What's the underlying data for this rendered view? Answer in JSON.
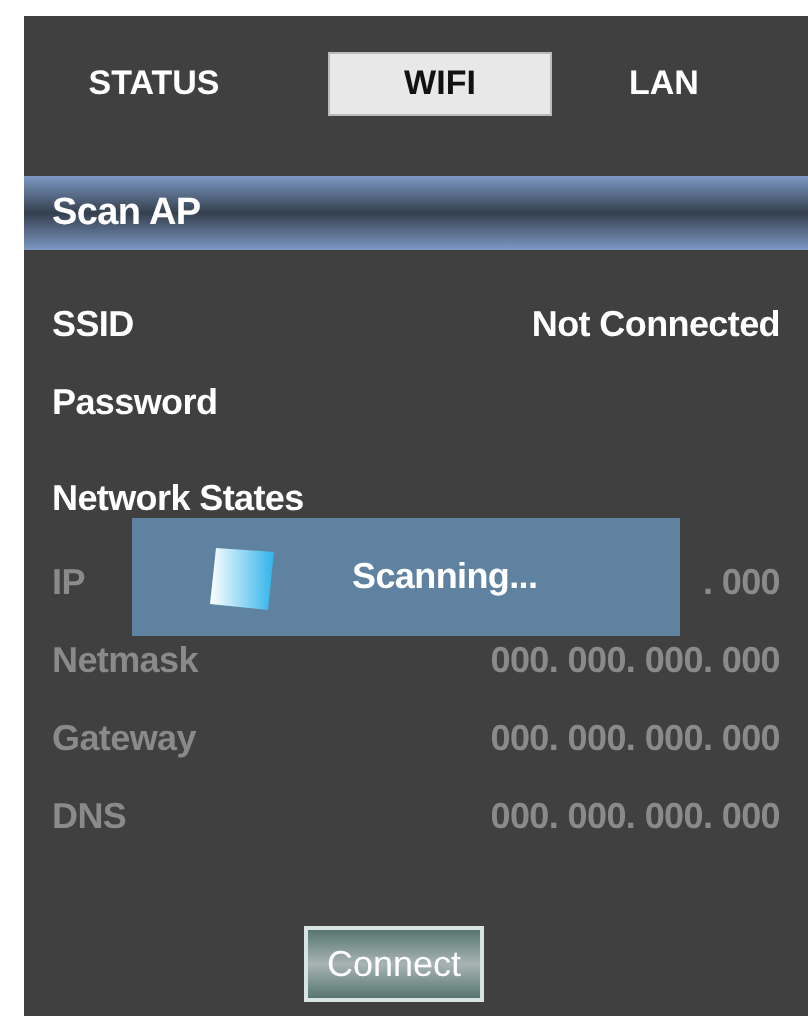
{
  "tabs": [
    {
      "label": "STATUS",
      "selected": false
    },
    {
      "label": "WIFI",
      "selected": true
    },
    {
      "label": "LAN",
      "selected": false
    }
  ],
  "section": {
    "title": "Scan AP"
  },
  "ssid": {
    "label": "SSID",
    "value": "Not Connected"
  },
  "password": {
    "label": "Password"
  },
  "network_states": {
    "title": "Network States",
    "rows": [
      {
        "label": "IP",
        "value": ". 000"
      },
      {
        "label": "Netmask",
        "value": "000. 000. 000. 000"
      },
      {
        "label": "Gateway",
        "value": "000. 000. 000. 000"
      },
      {
        "label": "DNS",
        "value": "000. 000. 000. 000"
      }
    ]
  },
  "dialog": {
    "message": "Scanning..."
  },
  "buttons": [
    "Connect"
  ]
}
